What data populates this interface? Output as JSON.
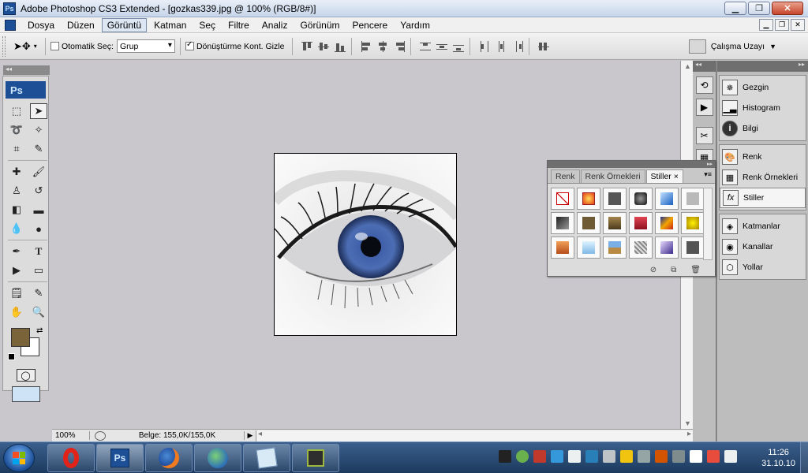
{
  "window": {
    "title": "Adobe Photoshop CS3 Extended - [gozkas339.jpg @ 100% (RGB/8#)]",
    "app_badge": "Ps"
  },
  "menu": {
    "items": [
      "Dosya",
      "Düzen",
      "Görüntü",
      "Katman",
      "Seç",
      "Filtre",
      "Analiz",
      "Görünüm",
      "Pencere",
      "Yardım"
    ],
    "active_index": 2
  },
  "options": {
    "auto_select_label": "Otomatik Seç:",
    "auto_select_checked": false,
    "auto_select_value": "Grup",
    "transform_label": "Dönüştürme Kont. Gizle",
    "transform_checked": true,
    "workspace_label": "Çalışma Uzayı"
  },
  "toolbox": {
    "badge": "Ps",
    "foreground_color": "#7b6339",
    "background_color": "#ffffff"
  },
  "status": {
    "zoom": "100%",
    "doc_info": "Belge: 155,0K/155,0K"
  },
  "dock": {
    "group1": [
      "Gezgin",
      "Histogram",
      "Bilgi"
    ],
    "group2": [
      "Renk",
      "Renk Örnekleri",
      "Stiller"
    ],
    "group2_selected": 2,
    "group3": [
      "Katmanlar",
      "Kanallar",
      "Yollar"
    ]
  },
  "styles_panel": {
    "tabs": [
      "Renk",
      "Renk Örnekleri",
      "Stiller"
    ],
    "active_tab": 2,
    "close_glyph": "×"
  },
  "taskbar": {
    "time": "11:26",
    "date": "31.10.10"
  }
}
